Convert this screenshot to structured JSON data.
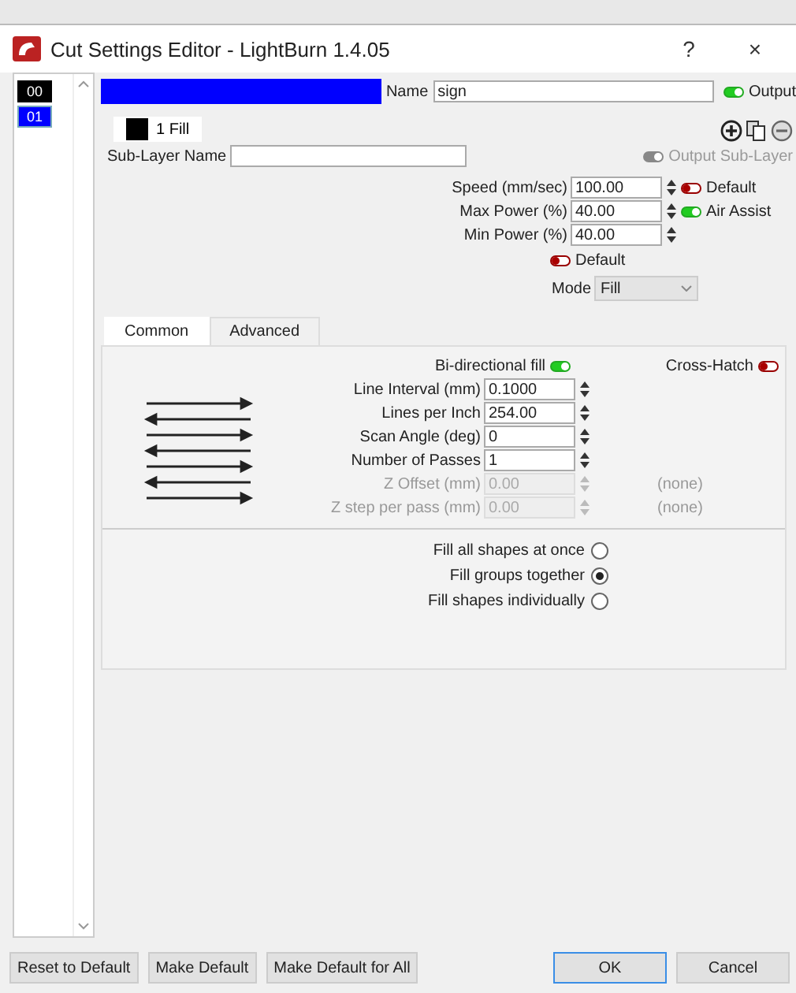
{
  "window": {
    "title": "Cut Settings Editor - LightBurn 1.4.05",
    "help": "?",
    "close": "×"
  },
  "layers": [
    {
      "label": "00",
      "color": "#000000",
      "selected": false
    },
    {
      "label": "01",
      "color": "#0000ff",
      "selected": true
    }
  ],
  "name": {
    "label": "Name",
    "value": "sign"
  },
  "output": {
    "label": "Output",
    "on": true
  },
  "sublayer_tab": {
    "label": "1 Fill",
    "color": "#000000"
  },
  "sublayer_name": {
    "label": "Sub-Layer Name"
  },
  "output_sublayer": {
    "label": "Output Sub-Layer",
    "on": true,
    "disabled": true
  },
  "speed_fields": [
    {
      "label": "Speed (mm/sec)",
      "value": "100.00",
      "toggle": {
        "label": "Default",
        "on": false
      }
    },
    {
      "label": "Max Power (%)",
      "value": "40.00",
      "toggle": {
        "label": "Air Assist",
        "on": true
      }
    },
    {
      "label": "Min Power (%)",
      "value": "40.00"
    }
  ],
  "power_default": {
    "label": "Default",
    "on": false
  },
  "mode": {
    "label": "Mode",
    "value": "Fill"
  },
  "tabs": [
    {
      "label": "Common",
      "selected": true
    },
    {
      "label": "Advanced",
      "selected": false
    }
  ],
  "bidirectional": {
    "label": "Bi-directional fill",
    "on": true
  },
  "crosshatch": {
    "label": "Cross-Hatch",
    "on": false
  },
  "fill_fields": [
    {
      "label": "Line Interval (mm)",
      "value": "0.1000",
      "disabled": false
    },
    {
      "label": "Lines per Inch",
      "value": "254.00",
      "disabled": false
    },
    {
      "label": "Scan Angle (deg)",
      "value": "0",
      "disabled": false
    },
    {
      "label": "Number of Passes",
      "value": "1",
      "disabled": false
    },
    {
      "label": "Z Offset (mm)",
      "value": "0.00",
      "disabled": true,
      "note": "(none)"
    },
    {
      "label": "Z step per pass (mm)",
      "value": "0.00",
      "disabled": true,
      "note": "(none)"
    }
  ],
  "fill_options": [
    {
      "label": "Fill all shapes at once",
      "selected": false
    },
    {
      "label": "Fill groups together",
      "selected": true
    },
    {
      "label": "Fill shapes individually",
      "selected": false
    }
  ],
  "buttons": [
    {
      "label": "Reset to Default",
      "default": false
    },
    {
      "label": "Make Default",
      "default": false
    },
    {
      "label": "Make Default for All",
      "default": false
    },
    {
      "label": "OK",
      "default": true
    },
    {
      "label": "Cancel",
      "default": false
    }
  ]
}
